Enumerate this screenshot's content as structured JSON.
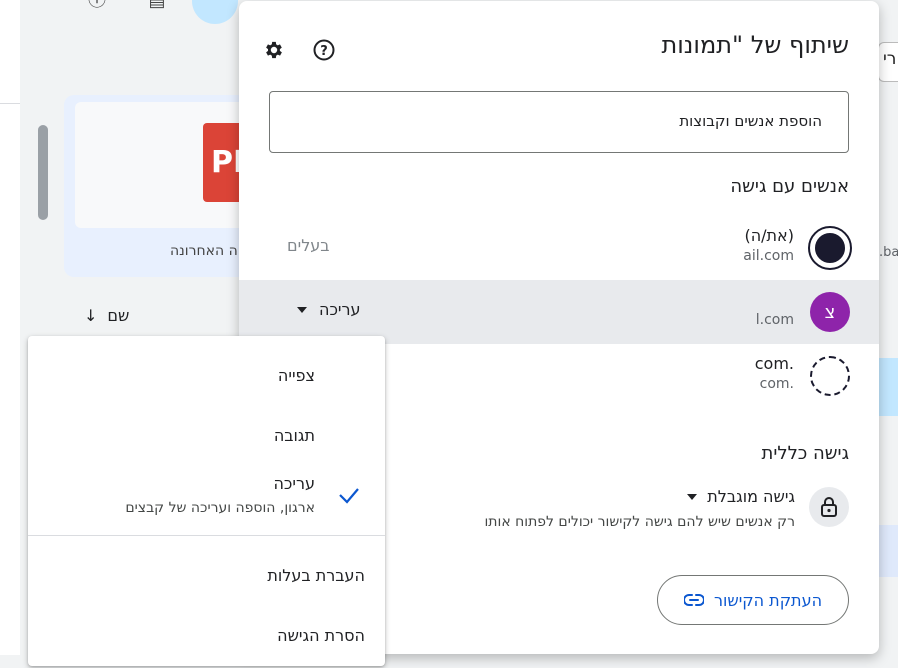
{
  "background": {
    "card_caption": "ה האחרונה",
    "pdf_label": "PI",
    "sort_label": "שם",
    "right_tab_text": "רי",
    "right_text": ".ba"
  },
  "dialog": {
    "title": "שיתוף של \"תמונות",
    "title_redacted": " ...",
    "settings_icon": "gear-icon",
    "help_icon": "help-circle-icon",
    "add_people_placeholder": "הוספת אנשים וקבוצות",
    "people_heading": "אנשים עם גישה",
    "people": [
      {
        "name": "(את/ה)",
        "email": "ail.com",
        "role": "בעלים",
        "avatar_letter": "",
        "avatar_color": "#ffffff"
      },
      {
        "name": "",
        "email": "l.com",
        "role": "עריכה",
        "avatar_letter": "צ",
        "avatar_color": "#8e24aa"
      },
      {
        "name": ".com",
        "email": ".com",
        "role": "",
        "avatar_letter": "",
        "avatar_color": "#ffffff"
      }
    ],
    "general_access_heading": "גישה כללית",
    "access_level": "גישה מוגבלת",
    "access_description": "רק אנשים שיש להם גישה לקישור יכולים לפתוח אותו",
    "copy_link_label": "העתקת הקישור",
    "accent_color": "#0b57d0"
  },
  "role_menu": {
    "items": [
      {
        "label": "צפייה",
        "sub": ""
      },
      {
        "label": "תגובה",
        "sub": ""
      },
      {
        "label": "עריכה",
        "sub": "ארגון, הוספה ועריכה של קבצים",
        "checked": true
      }
    ],
    "transfer_label": "העברת בעלות",
    "remove_label": "הסרת הגישה"
  }
}
